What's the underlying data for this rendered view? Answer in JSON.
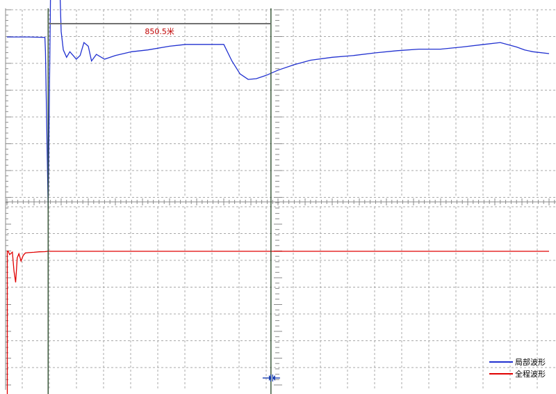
{
  "colors": {
    "background": "#ffffff",
    "grid": "#a8a8a8",
    "axis": "#8a8a8a",
    "cursor": "#2f4f2f",
    "local_wave": "#2030d0",
    "full_wave": "#e00000",
    "distance_bar": "#707070",
    "distance_text": "#c00000",
    "marker": "#1a3fb0"
  },
  "distance": {
    "label": "850.5米"
  },
  "marker": {
    "icon": "zoom-marker-icon"
  },
  "chart_data": {
    "type": "line",
    "grid": true,
    "legend_position": "bottom-right",
    "series": [
      {
        "name": "局部波形",
        "color": "#2030d0",
        "x": [
          0,
          4,
          7,
          7.1,
          7.6,
          8.1,
          8.2,
          9.4,
          9.8,
          10,
          10.4,
          11,
          11.6,
          12.2,
          12.8,
          13.5,
          14.2,
          15,
          15.6,
          16.5,
          18,
          20,
          23,
          26,
          30,
          33,
          36,
          38,
          40,
          41.5,
          43,
          44.5,
          46,
          48,
          50,
          53,
          56,
          60,
          64,
          68,
          72,
          76,
          80,
          84,
          88,
          91,
          94,
          95.5,
          97,
          100
        ],
        "y": [
          0.45,
          0.45,
          0.44,
          0.05,
          -4.2,
          2.5,
          2.6,
          2.6,
          1.6,
          0.6,
          0.1,
          -0.1,
          0.05,
          -0.05,
          -0.15,
          -0.05,
          0.3,
          0.2,
          -0.2,
          -0.02,
          -0.15,
          -0.05,
          0.05,
          0.1,
          0.2,
          0.25,
          0.25,
          0.25,
          0.25,
          -0.2,
          -0.55,
          -0.7,
          -0.68,
          -0.58,
          -0.45,
          -0.3,
          -0.18,
          -0.1,
          -0.05,
          0.02,
          0.08,
          0.12,
          0.12,
          0.18,
          0.25,
          0.3,
          0.18,
          0.1,
          0.05,
          0.0
        ]
      },
      {
        "name": "全程波形",
        "color": "#e00000",
        "x": [
          0,
          0.2,
          0.5,
          1,
          1.3,
          1.6,
          1.9,
          2.2,
          2.6,
          3,
          3.4,
          4,
          5,
          6,
          7,
          7.5,
          8.5,
          10,
          20,
          40,
          60,
          80,
          100
        ],
        "y": [
          0,
          0.02,
          -0.2,
          -0.05,
          -1.2,
          -1.9,
          -0.4,
          -0.15,
          -0.6,
          -0.25,
          -0.1,
          -0.08,
          -0.06,
          -0.03,
          -0.02,
          0,
          0,
          0,
          0,
          0,
          0,
          0,
          0
        ]
      }
    ],
    "cursors": [
      7.6,
      48.7
    ],
    "annotation": "850.5米"
  }
}
